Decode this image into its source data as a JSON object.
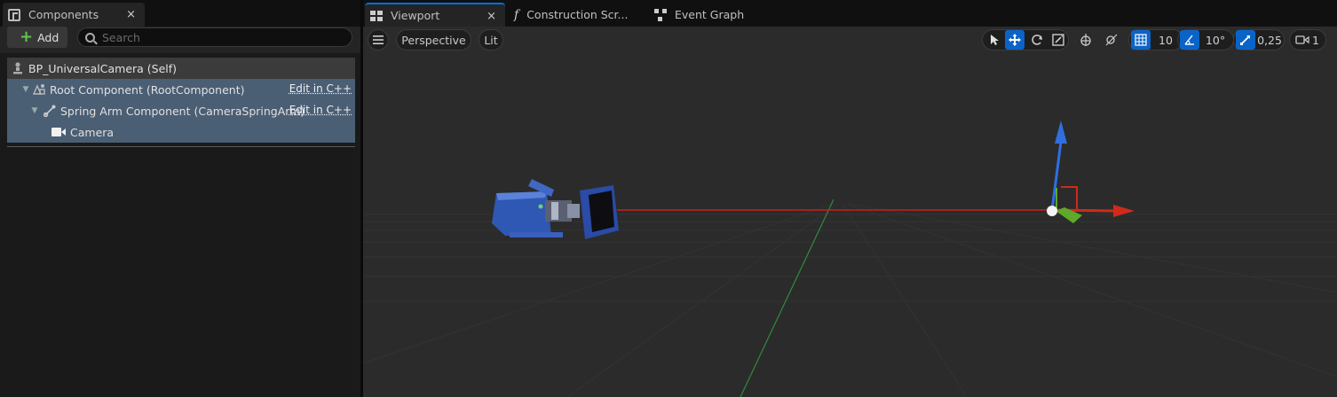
{
  "left_panel": {
    "tab": {
      "label": "Components",
      "close": "×"
    },
    "add_label": "Add",
    "search_placeholder": "Search",
    "tree": {
      "self_label": "BP_UniversalCamera (Self)",
      "root_label": "Root Component (RootComponent)",
      "spring_label": "Spring Arm Component (CameraSpringArm)",
      "camera_label": "Camera",
      "edit_cpp": "Edit in C++"
    }
  },
  "tabs": {
    "viewport": "Viewport",
    "viewport_close": "×",
    "construction": "Construction Scr...",
    "event_graph": "Event Graph"
  },
  "viewport_toolbar": {
    "perspective": "Perspective",
    "lit": "Lit",
    "grid_snap": "10",
    "rotation_snap": "10°",
    "scale_snap": "0,25",
    "camera_speed": "1"
  },
  "colors": {
    "accent": "#0a64c8",
    "selection": "#4a5e74",
    "x_axis": "#d02a1a",
    "y_axis": "#5fa82a",
    "z_axis": "#2f6fe0"
  }
}
